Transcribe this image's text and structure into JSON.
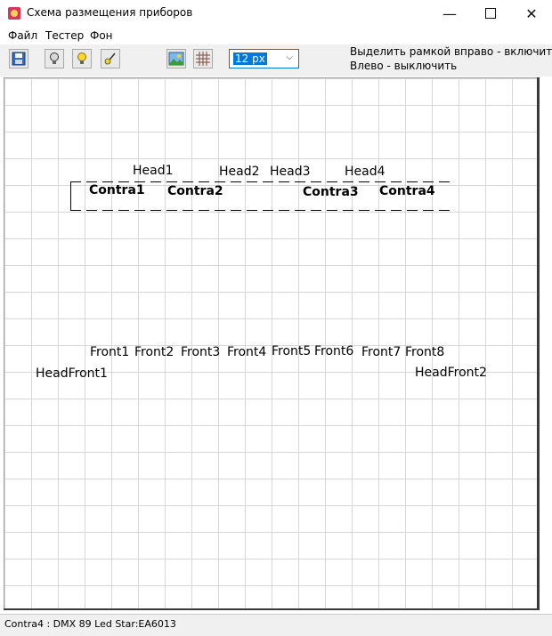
{
  "window": {
    "title": "Схема размещения приборов",
    "minimize": "—",
    "close": "✕"
  },
  "menu": [
    "Файл",
    "Тестер",
    "Фон"
  ],
  "toolbar": {
    "buttons": [
      {
        "name": "save-icon"
      },
      {
        "name": "lamp-off-icon"
      },
      {
        "name": "lamp-on-icon"
      },
      {
        "name": "brush-icon"
      },
      {
        "name": "background-image-icon"
      },
      {
        "name": "grid-icon"
      }
    ],
    "grid_size": "12 px",
    "dropdown_arrow": "⌵",
    "hint_line1": "Выделить рамкой вправо - включить",
    "hint_line2": "Влево - выключить"
  },
  "devices": {
    "head": [
      "Head1",
      "Head2",
      "Head3",
      "Head4"
    ],
    "contra": [
      "Contra1",
      "Contra2",
      "Contra3",
      "Contra4"
    ],
    "front": [
      "Front1",
      "Front2",
      "Front3",
      "Front4",
      "Front5",
      "Front6",
      "Front7",
      "Front8"
    ],
    "headfront": [
      "HeadFront1",
      "HeadFront2"
    ]
  },
  "status": {
    "text": "Contra4 : DMX 89 Led Star:EA6013"
  },
  "colors": {
    "grid_line": "#d6d6d6",
    "selection": "#0078d7",
    "toolbar_bg": "#f0f0f0"
  }
}
